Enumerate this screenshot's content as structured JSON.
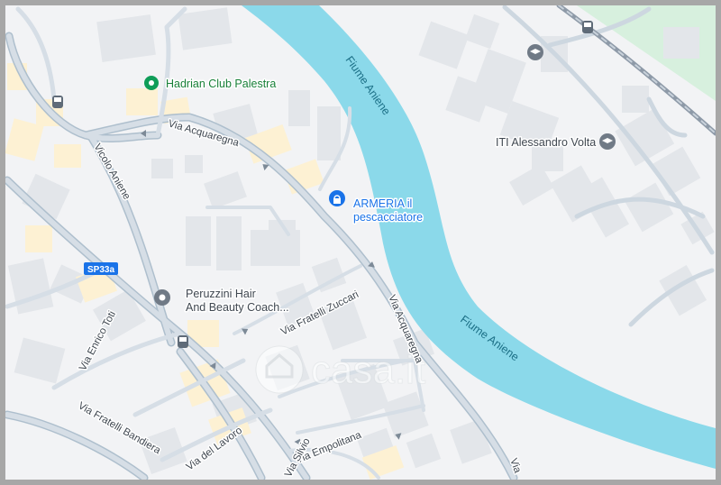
{
  "map": {
    "pois": [
      {
        "name": "Hadrian Club Palestra",
        "category": "gym",
        "icon": "map-pin-icon",
        "color": "#0f9d58"
      },
      {
        "name": "ARMERIA il pescacciatore",
        "category": "shop",
        "icon": "shopping-bag-icon",
        "color": "#1a73e8"
      },
      {
        "name": "Peruzzini Hair And Beauty Coach...",
        "category": "salon",
        "icon": "salon-pin-icon",
        "color": "#707a86"
      },
      {
        "name": "ITI Alessandro Volta",
        "category": "school",
        "icon": "school-icon",
        "color": "#707a86"
      }
    ],
    "streets": [
      "Via Acquaregna",
      "Vicolo Aniene",
      "Via Fratelli Zuccari",
      "Via Enrico Toti",
      "Via Fratelli Bandiera",
      "Via del Lavoro",
      "Via Empolitana",
      "Via Silvio",
      "Via"
    ],
    "road_shield": "SP33a",
    "river": "Fiume Aniene",
    "watermark": "casa.it",
    "colors": {
      "background": "#f2f3f5",
      "road": "#c9d4de",
      "road_casing": "#aebfcd",
      "building": "#e3e6ea",
      "building_highlight": "#fdf1d3",
      "river": "#8bd9ea",
      "park": "#d7f0de",
      "railway": "#8e9aa8"
    }
  }
}
